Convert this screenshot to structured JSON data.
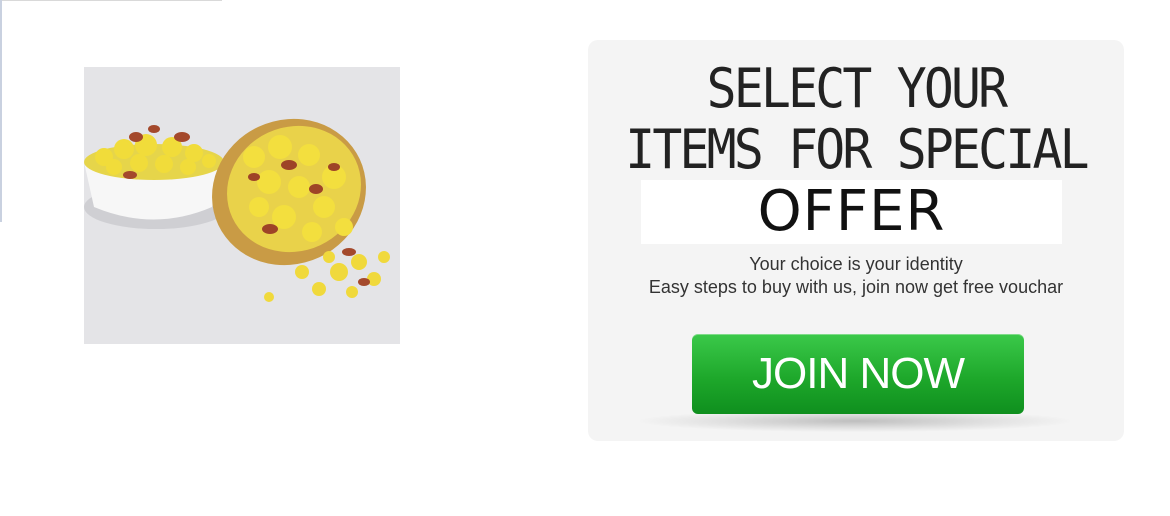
{
  "offer": {
    "headline_line1": "SELECT YOUR",
    "headline_line2": "ITEMS FOR SPECIAL",
    "offer_word": "OFFER",
    "tagline_line1": "Your choice is your identity",
    "tagline_line2": "Easy steps to buy with us, join now get free vouchar",
    "join_label": "JOIN NOW"
  },
  "colors": {
    "button_green": "#1ea82b",
    "panel_bg": "#f4f4f4"
  },
  "image": {
    "icon": "snack-bowl-image"
  }
}
